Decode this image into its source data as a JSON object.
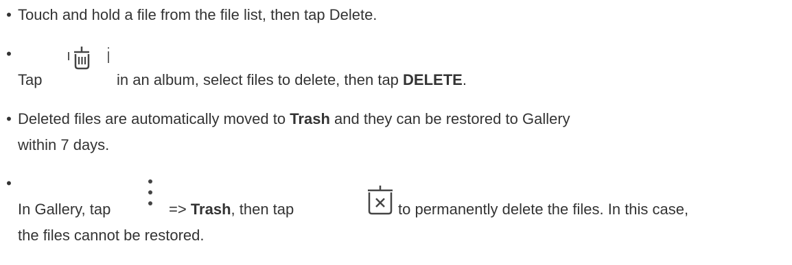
{
  "items": [
    {
      "text": "Touch and hold a file from the file list, then tap Delete."
    },
    {
      "pre": "Tap",
      "icon": "trash-icon",
      "mid": "in an album, select files to delete, then tap ",
      "bold": "DELETE",
      "post": "."
    },
    {
      "pre": "Deleted files are automatically moved to ",
      "bold": "Trash",
      "post": " and they can be restored to Gallery",
      "line2": "within 7 days."
    },
    {
      "pre": "In Gallery, tap",
      "icon1": "more-vertical-icon",
      "mid1": "=> ",
      "bold": "Trash",
      "mid2": ", then tap",
      "icon2": "delete-forever-icon",
      "post": "to permanently delete the files. In this case,",
      "line2": "the files cannot be restored."
    }
  ]
}
